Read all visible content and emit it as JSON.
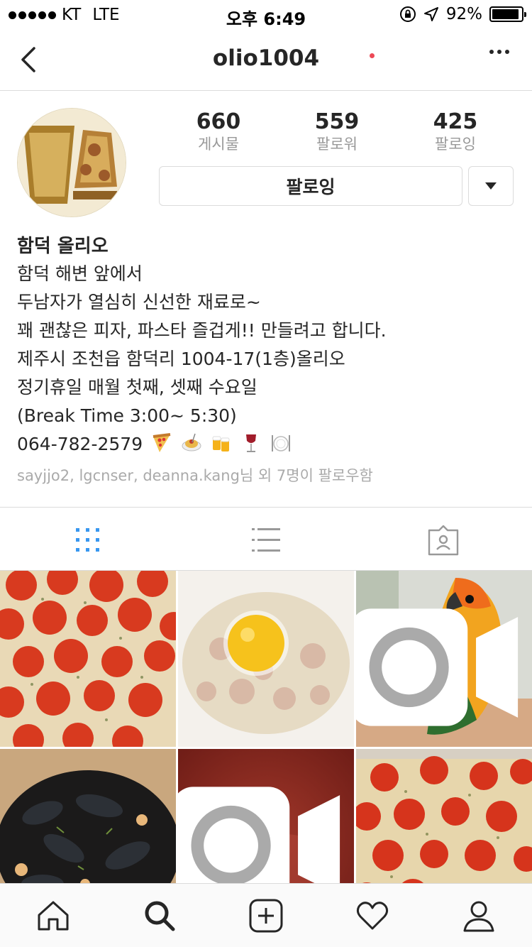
{
  "status_bar": {
    "carrier": "KT",
    "network": "LTE",
    "time": "오후 6:49",
    "battery": "92%",
    "battery_level": 0.92
  },
  "nav": {
    "title": "olio1004"
  },
  "profile": {
    "stats": [
      {
        "count": "660",
        "label": "게시물"
      },
      {
        "count": "559",
        "label": "팔로워"
      },
      {
        "count": "425",
        "label": "팔로잉"
      }
    ],
    "follow_button": "팔로잉",
    "name": "함덕 올리오",
    "bio_lines": [
      "함덕 해변 앞에서",
      "두남자가 열심히 신선한 재료로~",
      "꽤 괜찮은 피자, 파스타 즐겁게!! 만들려고 합니다.",
      "제주시 조천읍 함덕리 1004-17(1층)올리오",
      "정기휴일 매월 첫째, 셋째 수요일",
      "(Break Time 3:00~ 5:30)"
    ],
    "phone": "064-782-2579",
    "phone_emojis": [
      "pizza-icon",
      "spaghetti-icon",
      "beer-mugs-icon",
      "wine-glass-icon",
      "plate-cutlery-icon"
    ],
    "followed_by": "sayjjo2, lgcnser, deanna.kang님 외 7명이 팔로우함"
  },
  "tabs": [
    "grid-view",
    "list-view",
    "tagged-view"
  ],
  "active_tab": "grid-view",
  "grid": [
    {
      "subject": "pepperoni pizza",
      "video": false
    },
    {
      "subject": "carbonara with egg yolk",
      "video": false
    },
    {
      "subject": "sun conure parrot",
      "video": true
    },
    {
      "subject": "mussels in pot",
      "video": false
    },
    {
      "subject": "tomato sauce",
      "video": true
    },
    {
      "subject": "pepperoni pizza",
      "video": false
    }
  ],
  "colors": {
    "accent_blue": "#3897f0",
    "border": "#dbdbdb",
    "muted_text": "#999999",
    "notification_red": "#ed4956"
  }
}
